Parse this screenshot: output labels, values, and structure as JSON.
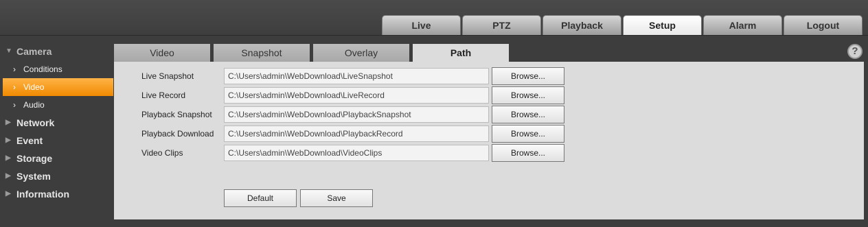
{
  "top_tabs": [
    {
      "label": "Live"
    },
    {
      "label": "PTZ"
    },
    {
      "label": "Playback"
    },
    {
      "label": "Setup",
      "active": true
    },
    {
      "label": "Alarm"
    },
    {
      "label": "Logout"
    }
  ],
  "sidebar": {
    "camera": "Camera",
    "conditions": "Conditions",
    "video": "Video",
    "audio": "Audio",
    "network": "Network",
    "event": "Event",
    "storage": "Storage",
    "system": "System",
    "information": "Information"
  },
  "sub_tabs": [
    {
      "label": "Video"
    },
    {
      "label": "Snapshot"
    },
    {
      "label": "Overlay"
    },
    {
      "label": "Path",
      "active": true
    }
  ],
  "help_icon": "?",
  "paths": [
    {
      "label": "Live Snapshot",
      "value": "C:\\Users\\admin\\WebDownload\\LiveSnapshot",
      "browse": "Browse..."
    },
    {
      "label": "Live Record",
      "value": "C:\\Users\\admin\\WebDownload\\LiveRecord",
      "browse": "Browse..."
    },
    {
      "label": "Playback Snapshot",
      "value": "C:\\Users\\admin\\WebDownload\\PlaybackSnapshot",
      "browse": "Browse..."
    },
    {
      "label": "Playback Download",
      "value": "C:\\Users\\admin\\WebDownload\\PlaybackRecord",
      "browse": "Browse..."
    },
    {
      "label": "Video Clips",
      "value": "C:\\Users\\admin\\WebDownload\\VideoClips",
      "browse": "Browse..."
    }
  ],
  "actions": {
    "default": "Default",
    "save": "Save"
  },
  "colors": {
    "accent": "#f08a00",
    "background": "#3d3d3d",
    "panel": "#dcdcdc"
  }
}
